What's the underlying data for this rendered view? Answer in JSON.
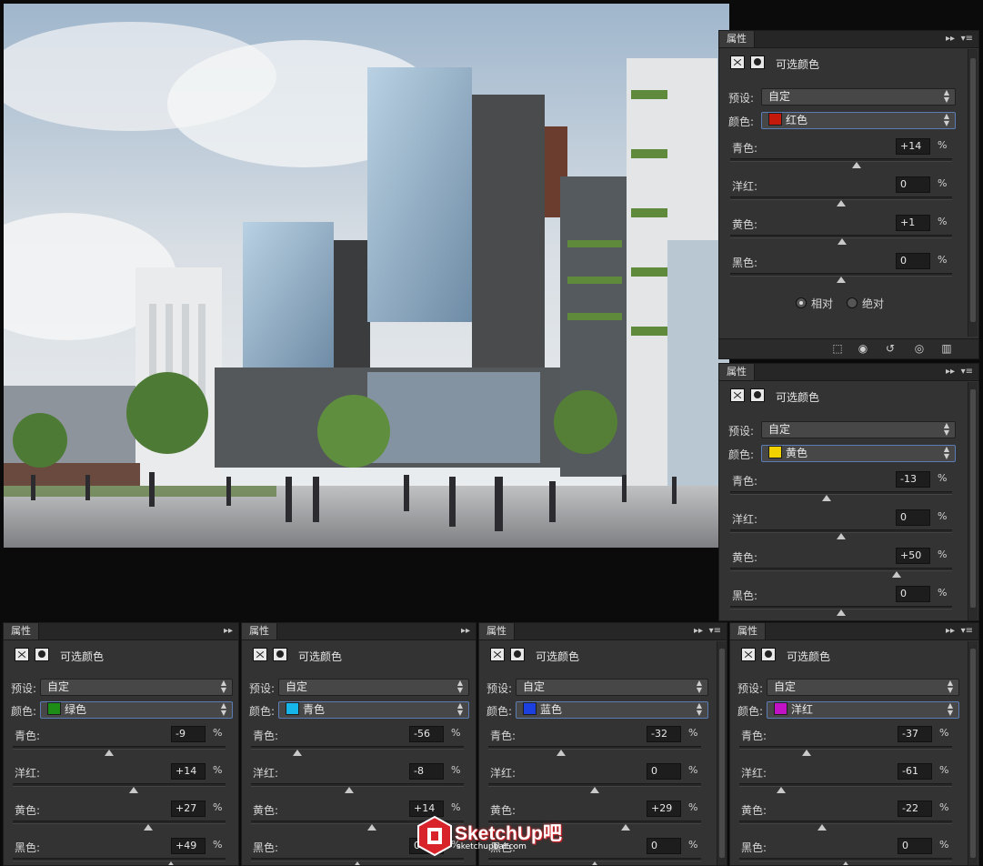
{
  "panel_common": {
    "tab_label": "属性",
    "panel_title": "可选颜色",
    "preset_label": "预设:",
    "preset_value": "自定",
    "colors_label": "颜色:",
    "cyan_label": "青色:",
    "magenta_label": "洋红:",
    "yellow_label": "黄色:",
    "black_label": "黑色:",
    "pct": "%",
    "collapse_glyph": "▸▸",
    "menu_glyph": "▾≡"
  },
  "panels": [
    {
      "id": "reds",
      "color_name": "红色",
      "swatch": "#c41a0b",
      "cyan": "+14",
      "magenta": "0",
      "yellow": "+1",
      "black": "0",
      "cyan_f": 0.57,
      "magenta_f": 0.5,
      "yellow_f": 0.505,
      "black_f": 0.5
    },
    {
      "id": "yellows",
      "color_name": "黄色",
      "swatch": "#f2d100",
      "cyan": "-13",
      "magenta": "0",
      "yellow": "+50",
      "black": "0",
      "cyan_f": 0.435,
      "magenta_f": 0.5,
      "yellow_f": 0.75,
      "black_f": 0.5
    },
    {
      "id": "greens",
      "color_name": "绿色",
      "swatch": "#1e8d18",
      "cyan": "-9",
      "magenta": "+14",
      "yellow": "+27",
      "black": "+49",
      "cyan_f": 0.455,
      "magenta_f": 0.57,
      "yellow_f": 0.635,
      "black_f": 0.745
    },
    {
      "id": "cyans",
      "color_name": "青色",
      "swatch": "#16b6ea",
      "cyan": "-56",
      "magenta": "-8",
      "yellow": "+14",
      "black": "0",
      "cyan_f": 0.22,
      "magenta_f": 0.46,
      "yellow_f": 0.57,
      "black_f": 0.5
    },
    {
      "id": "blues",
      "color_name": "蓝色",
      "swatch": "#1c3fe0",
      "cyan": "-32",
      "magenta": "0",
      "yellow": "+29",
      "black": "0",
      "cyan_f": 0.34,
      "magenta_f": 0.5,
      "yellow_f": 0.645,
      "black_f": 0.5
    },
    {
      "id": "magentas",
      "color_name": "洋红",
      "swatch": "#c212c6",
      "cyan": "-37",
      "magenta": "-61",
      "yellow": "-22",
      "black": "0",
      "cyan_f": 0.315,
      "magenta_f": 0.195,
      "yellow_f": 0.39,
      "black_f": 0.5
    }
  ],
  "method": {
    "relative_label": "相对",
    "absolute_label": "绝对",
    "selected": "relative"
  },
  "watermark": {
    "brand": "SketchUp吧",
    "url": "sketchupbar.com"
  }
}
